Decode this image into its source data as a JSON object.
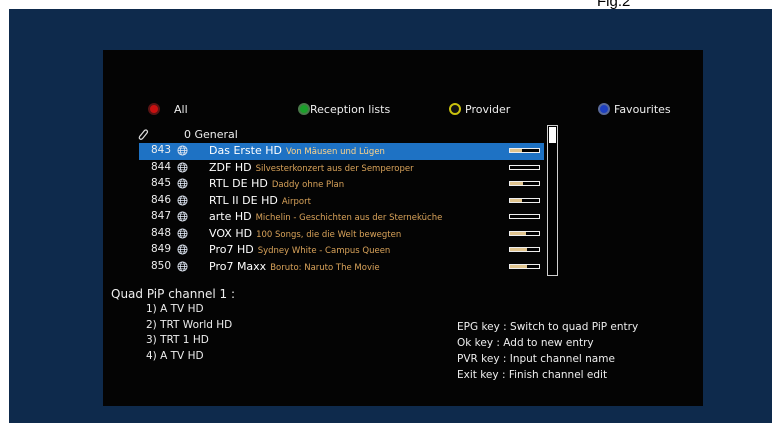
{
  "figure_label": "Fig.2",
  "color_keys": {
    "red": {
      "label": "All",
      "color": "#c81010"
    },
    "green": {
      "label": "Reception lists",
      "color": "#1aa02a"
    },
    "yellow": {
      "label": "Provider",
      "color": "#c9c10e"
    },
    "blue": {
      "label": "Favourites",
      "color": "#1d3fc0"
    }
  },
  "group": {
    "label": "0 General",
    "icon": "paperclip-icon"
  },
  "channels": [
    {
      "number": "843",
      "name": "Das Erste HD",
      "epg": "Von Mäusen und Lügen",
      "signal": 0.4,
      "selected": true
    },
    {
      "number": "844",
      "name": "ZDF HD",
      "epg": "Silvesterkonzert aus der Semperoper",
      "signal": 0.0,
      "selected": false
    },
    {
      "number": "845",
      "name": "RTL DE HD",
      "epg": "Daddy ohne Plan",
      "signal": 0.45,
      "selected": false
    },
    {
      "number": "846",
      "name": "RTL II DE HD",
      "epg": "Airport",
      "signal": 0.4,
      "selected": false
    },
    {
      "number": "847",
      "name": "arte HD",
      "epg": "Michelin - Geschichten aus der Sterneküche",
      "signal": 0.0,
      "selected": false
    },
    {
      "number": "848",
      "name": "VOX HD",
      "epg": "100 Songs, die die Welt bewegten",
      "signal": 0.55,
      "selected": false
    },
    {
      "number": "849",
      "name": "Pro7 HD",
      "epg": "Sydney White - Campus Queen",
      "signal": 0.6,
      "selected": false
    },
    {
      "number": "850",
      "name": "Pro7 Maxx",
      "epg": "Boruto: Naruto The Movie",
      "signal": 0.6,
      "selected": false
    }
  ],
  "quad_pip": {
    "title": "Quad PiP channel 1 :",
    "entries": [
      "1) A TV HD",
      "2) TRT World HD",
      "3) TRT 1 HD",
      "4) A TV HD"
    ]
  },
  "help": [
    "EPG key : Switch to quad PiP entry",
    "Ok key : Add to new entry",
    "PVR key : Input channel name",
    "Exit key : Finish channel edit"
  ],
  "colors": {
    "selected_row": "#1e72c4",
    "epg_text": "#d9a35a",
    "signal_fill": "#e0c48e",
    "frame": "#0e2a4c"
  }
}
